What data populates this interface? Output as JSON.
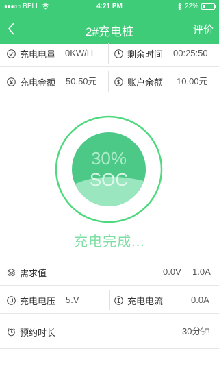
{
  "status_bar": {
    "carrier": "BELL",
    "time": "4:21 PM",
    "battery": "22%",
    "battery_level": 0.22
  },
  "nav": {
    "title": "2#充电桩",
    "right_action": "评价",
    "back_icon": "chevron-left-icon"
  },
  "info": {
    "charge_amount_label": "充电电量",
    "charge_amount_value": "0KW/H",
    "remaining_time_label": "剩余时间",
    "remaining_time_value": "00:25:50",
    "charge_cost_label": "充电金额",
    "charge_cost_value": "50.50元",
    "balance_label": "账户余额",
    "balance_value": "10.00元"
  },
  "gauge": {
    "percent_text": "30%",
    "soc_text": "SOC",
    "level": 0.3
  },
  "status_text": "充电完成...",
  "details": {
    "demand_label": "需求值",
    "demand_voltage": "0.0V",
    "demand_current": "1.0A",
    "voltage_label": "充电电压",
    "voltage_value": "5.V",
    "current_label": "充电电流",
    "current_value": "0.0A",
    "reserve_label": "预约时长",
    "reserve_value": "30分钟"
  },
  "colors": {
    "accent": "#3ecc78",
    "gauge_dark": "#4cc887",
    "gauge_light": "#9ae6bf",
    "ring": "#4fd97f"
  }
}
